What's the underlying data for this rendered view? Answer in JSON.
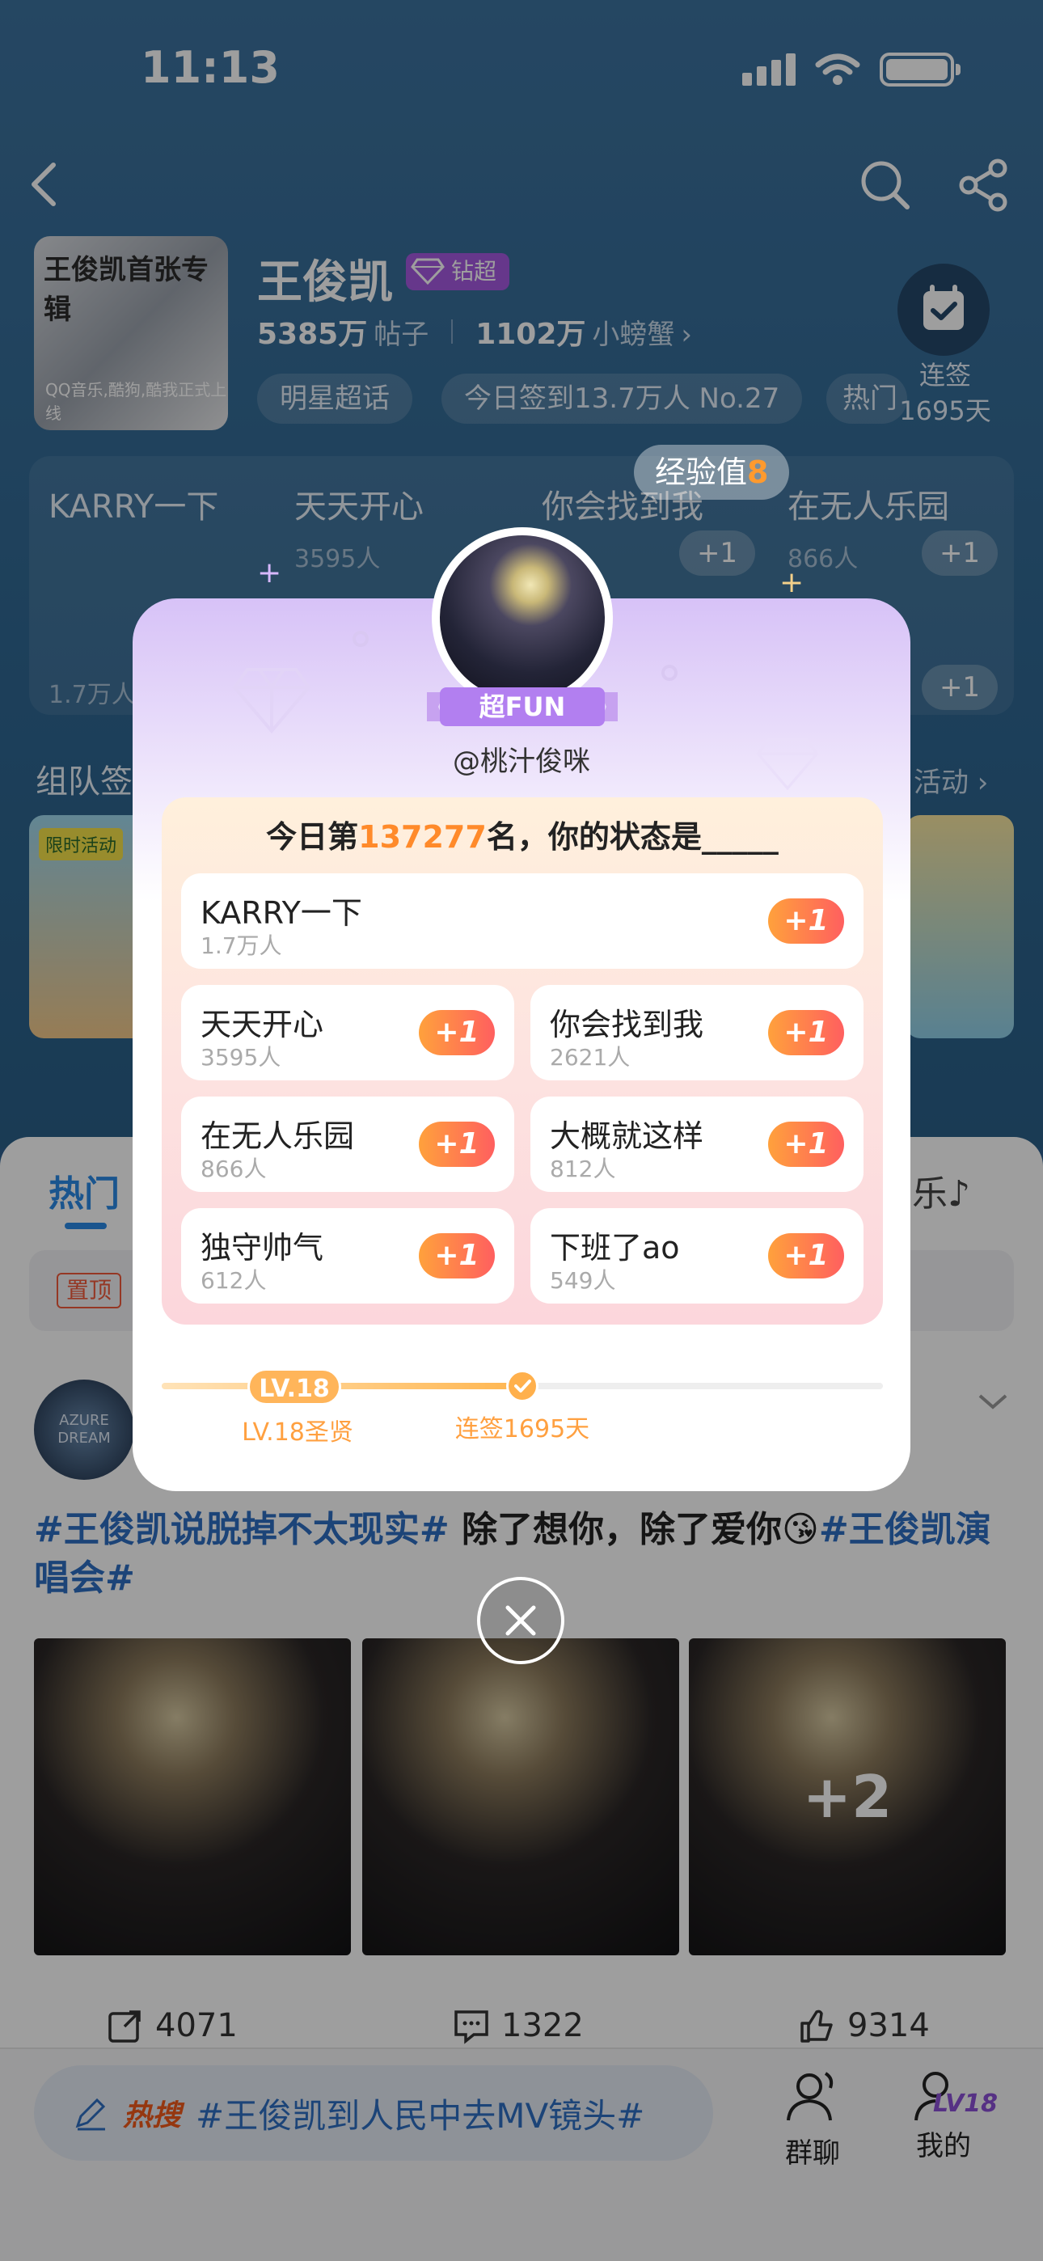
{
  "status_bar": {
    "time": "11:13"
  },
  "topic": {
    "cover_title": "王俊凯首张专辑",
    "cover_caption": "QQ音乐,酷狗,酷我正式上线",
    "name": "王俊凯",
    "level_badge": "钻超",
    "posts_count": "5385万",
    "posts_label": "帖子",
    "fans_count": "1102万",
    "fans_label": "小螃蟹",
    "chips": [
      "明星超话",
      "今日签到13.7万人 No.27",
      "热门"
    ],
    "checkin_label": "连签",
    "checkin_days": "1695天"
  },
  "background_hot": {
    "words": [
      "KARRY一下",
      "天天开心",
      "你会找到我",
      "在无人乐园"
    ],
    "subs": [
      "3595人",
      "866人",
      "1.7万人"
    ],
    "plus": "+1",
    "team_title": "组队签",
    "team_more": "活动",
    "team_tag": "限时活动"
  },
  "feed": {
    "tab_hot": "热门",
    "tab_music": "乐",
    "pin_badge": "置顶",
    "avatar_text": "AZURE DREAM",
    "post_tag1": "#王俊凯说脱掉不太现实#",
    "post_text": " 除了想你，除了爱你😘",
    "post_tag2": "#王俊凯演唱会#",
    "more_photos": "+2",
    "reposts": "4071",
    "comments": "1322",
    "likes": "9314"
  },
  "bottom": {
    "hot_label": "热搜",
    "hot_search": "#王俊凯到人民中去MV镜头#",
    "group_chat": "群聊",
    "mine": "我的",
    "mine_level": "LV18"
  },
  "modal": {
    "exp_label": "经验值",
    "exp_value": "8",
    "fun_badge": "超FUN",
    "username": "@桃汁俊咪",
    "rank_prefix": "今日第",
    "rank_number": "137277",
    "rank_suffix": "名，你的状态是_____",
    "options": [
      {
        "name": "KARRY一下",
        "count": "1.7万人"
      },
      {
        "name": "天天开心",
        "count": "3595人"
      },
      {
        "name": "你会找到我",
        "count": "2621人"
      },
      {
        "name": "在无人乐园",
        "count": "866人"
      },
      {
        "name": "大概就这样",
        "count": "812人"
      },
      {
        "name": "独守帅气",
        "count": "612人"
      },
      {
        "name": "下班了ao",
        "count": "549人"
      }
    ],
    "plus_label": "+1",
    "level_pill": "LV.18",
    "level_caption": "LV.18圣贤",
    "streak_caption": "连签1695天",
    "progress_fraction": 0.5
  },
  "colors": {
    "accent_orange": "#ff8a2a",
    "accent_purple": "#a55ae0",
    "link_blue": "#2e6fc2"
  }
}
